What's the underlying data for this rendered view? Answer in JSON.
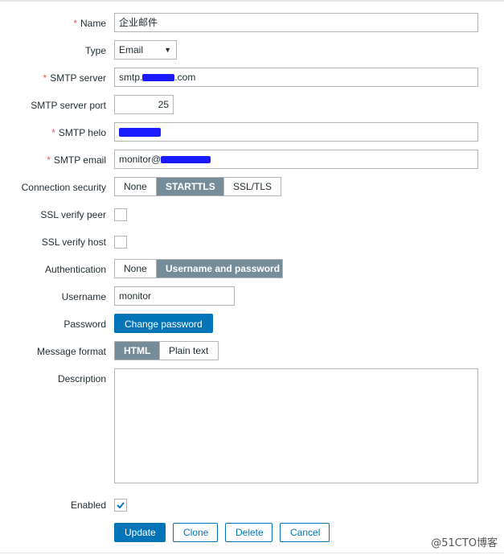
{
  "form": {
    "name": {
      "label": "Name",
      "value": "企业邮件"
    },
    "type": {
      "label": "Type",
      "value": "Email"
    },
    "smtp_server": {
      "label": "SMTP server",
      "value_prefix": "smtp.",
      "value_suffix": ".com"
    },
    "smtp_port": {
      "label": "SMTP server port",
      "value": "25"
    },
    "smtp_helo": {
      "label": "SMTP helo"
    },
    "smtp_email": {
      "label": "SMTP email",
      "value_prefix": "monitor@"
    },
    "connection_security": {
      "label": "Connection security",
      "options": [
        "None",
        "STARTTLS",
        "SSL/TLS"
      ],
      "selected": "STARTTLS"
    },
    "ssl_verify_peer": {
      "label": "SSL verify peer",
      "checked": false
    },
    "ssl_verify_host": {
      "label": "SSL verify host",
      "checked": false
    },
    "authentication": {
      "label": "Authentication",
      "options": [
        "None",
        "Username and password"
      ],
      "selected": "Username and password"
    },
    "username": {
      "label": "Username",
      "value": "monitor"
    },
    "password": {
      "label": "Password",
      "button": "Change password"
    },
    "message_format": {
      "label": "Message format",
      "options": [
        "HTML",
        "Plain text"
      ],
      "selected": "HTML"
    },
    "description": {
      "label": "Description",
      "value": ""
    },
    "enabled": {
      "label": "Enabled",
      "checked": true
    },
    "required_mark": "*"
  },
  "actions": {
    "update": "Update",
    "clone": "Clone",
    "delete": "Delete",
    "cancel": "Cancel"
  },
  "watermark": "@51CTO博客",
  "colors": {
    "accent": "#0275b8",
    "segment_active": "#768d99",
    "required": "#e45959",
    "redaction": "#1a1aff"
  },
  "icons": {
    "dropdown": "chevron-down-icon",
    "checkbox": "check-icon",
    "resize": "resize-grip-icon"
  }
}
